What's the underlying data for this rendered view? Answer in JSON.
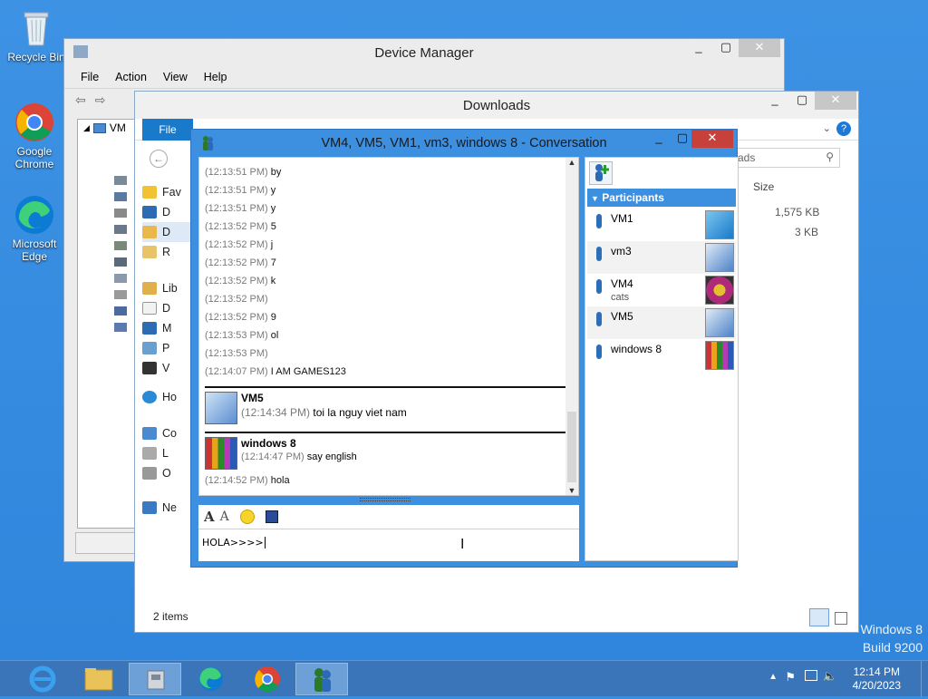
{
  "desktop_icons": [
    {
      "label": "Recycle Bin",
      "icon": "recycle-bin-icon"
    },
    {
      "label": "Google Chrome",
      "icon": "chrome-icon"
    },
    {
      "label": "Microsoft Edge",
      "icon": "edge-icon"
    }
  ],
  "device_manager": {
    "title": "Device Manager",
    "menu": [
      "File",
      "Action",
      "View",
      "Help"
    ],
    "tree_root": "VM"
  },
  "explorer": {
    "title": "Downloads",
    "file_tab": "File",
    "search_placeholder": "ads",
    "column_size": "Size",
    "sizes": [
      "1,575 KB",
      "3 KB"
    ],
    "nav": [
      "Fav",
      "D",
      "D",
      "R",
      "Lib",
      "D",
      "M",
      "P",
      "V",
      "Ho",
      "Co",
      "L",
      "O",
      "Ne"
    ],
    "status_items": "2 items"
  },
  "conversation": {
    "title": "VM4, VM5, VM1, vm3, windows 8 - Conversation",
    "messages": [
      {
        "ts": "(12:13:51 PM)",
        "text": "by"
      },
      {
        "ts": "(12:13:51 PM)",
        "text": "y"
      },
      {
        "ts": "(12:13:51 PM)",
        "text": "y"
      },
      {
        "ts": "(12:13:52 PM)",
        "text": "5"
      },
      {
        "ts": "(12:13:52 PM)",
        "text": "j"
      },
      {
        "ts": "(12:13:52 PM)",
        "text": "7"
      },
      {
        "ts": "(12:13:52 PM)",
        "text": "k"
      },
      {
        "ts": "(12:13:52 PM)",
        "text": ""
      },
      {
        "ts": "(12:13:52 PM)",
        "text": "9"
      },
      {
        "ts": "(12:13:53 PM)",
        "text": "ol"
      },
      {
        "ts": "(12:13:53 PM)",
        "text": ""
      },
      {
        "ts": "(12:14:07 PM)",
        "text": "I AM GAMES123"
      }
    ],
    "vm5_block": {
      "name": "VM5",
      "ts": "(12:14:34 PM)",
      "text": "toi la nguy viet nam"
    },
    "win8_block": {
      "name": "windows 8",
      "ts": "(12:14:47 PM)",
      "text": "say english"
    },
    "last_msg": {
      "ts": "(12:14:52 PM)",
      "text": "hola"
    },
    "input_value": "HOLA>>>>",
    "participants_label": "Participants",
    "participants": [
      {
        "name": "VM1",
        "status": ""
      },
      {
        "name": "vm3",
        "status": ""
      },
      {
        "name": "VM4",
        "status": "cats"
      },
      {
        "name": "VM5",
        "status": ""
      },
      {
        "name": "windows 8",
        "status": ""
      }
    ]
  },
  "taskbar": {
    "time": "12:14 PM",
    "date": "4/20/2023"
  },
  "watermark": {
    "line1": "Windows 8",
    "line2": "Build 9200"
  }
}
